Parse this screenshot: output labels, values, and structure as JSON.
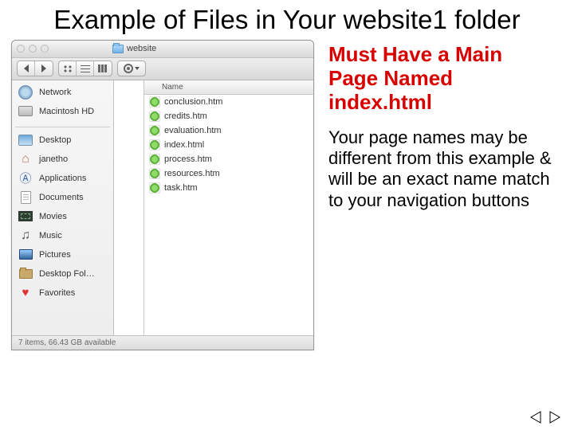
{
  "slide": {
    "title": "Example of Files in Your website1 folder",
    "callout": "Must Have a Main Page Named index.html",
    "body": "Your page names may be different from this example & will be an exact name match to  your navigation buttons"
  },
  "finder": {
    "window_title": "website",
    "column_header": "Name",
    "status": "7 items, 66.43 GB available",
    "sidebar": [
      {
        "label": "Network",
        "icon": "globe"
      },
      {
        "label": "Macintosh HD",
        "icon": "hdd"
      },
      {
        "label": "Desktop",
        "icon": "desktop"
      },
      {
        "label": "janetho",
        "icon": "home"
      },
      {
        "label": "Applications",
        "icon": "app"
      },
      {
        "label": "Documents",
        "icon": "doc"
      },
      {
        "label": "Movies",
        "icon": "movie"
      },
      {
        "label": "Music",
        "icon": "music"
      },
      {
        "label": "Pictures",
        "icon": "picture"
      },
      {
        "label": "Desktop Fol…",
        "icon": "folder"
      },
      {
        "label": "Favorites",
        "icon": "heart"
      }
    ],
    "files": [
      "conclusion.htm",
      "credits.htm",
      "evaluation.htm",
      "index.html",
      "process.htm",
      "resources.htm",
      "task.htm"
    ]
  }
}
